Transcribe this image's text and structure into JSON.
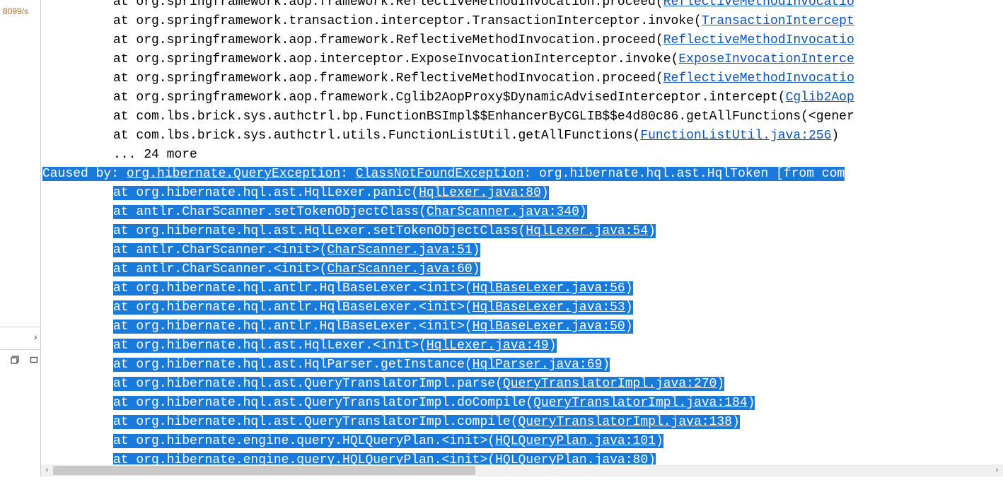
{
  "sidebar": {
    "top_text": "8099/s",
    "chevron_label": "›"
  },
  "trace": {
    "pre_lines": [
      {
        "prefix": "at org.springframework.aop.framework.ReflectiveMethodInvocation.proceed(",
        "link": "ReflectiveMethodInvocatio",
        "suffix": ""
      },
      {
        "prefix": "at org.springframework.transaction.interceptor.TransactionInterceptor.invoke(",
        "link": "TransactionIntercept",
        "suffix": ""
      },
      {
        "prefix": "at org.springframework.aop.framework.ReflectiveMethodInvocation.proceed(",
        "link": "ReflectiveMethodInvocatio",
        "suffix": ""
      },
      {
        "prefix": "at org.springframework.aop.interceptor.ExposeInvocationInterceptor.invoke(",
        "link": "ExposeInvocationInterce",
        "suffix": ""
      },
      {
        "prefix": "at org.springframework.aop.framework.ReflectiveMethodInvocation.proceed(",
        "link": "ReflectiveMethodInvocatio",
        "suffix": ""
      },
      {
        "prefix": "at org.springframework.aop.framework.Cglib2AopProxy$DynamicAdvisedInterceptor.intercept(",
        "link": "Cglib2Aop",
        "suffix": ""
      },
      {
        "prefix": "at com.lbs.brick.sys.authctrl.bp.FunctionBSImpl$$EnhancerByCGLIB$$e4d80c86.getAllFunctions(<gener",
        "link": "",
        "suffix": ""
      },
      {
        "prefix": "at com.lbs.brick.sys.authctrl.utils.FunctionListUtil.getAllFunctions(",
        "link": "FunctionListUtil.java:256",
        "suffix": ")"
      }
    ],
    "more_line": "... 24 more",
    "caused_by": {
      "label": "Caused by: ",
      "u1": "org.hibernate.QueryException",
      "mid1": ": ",
      "u2": "ClassNotFoundException",
      "mid2": ": org.hibernate.hql.ast.HqlToken [from com"
    },
    "sel_lines": [
      {
        "prefix": "at org.hibernate.hql.ast.HqlLexer.panic(",
        "link": "HqlLexer.java:80",
        "suffix": ")"
      },
      {
        "prefix": "at antlr.CharScanner.setTokenObjectClass(",
        "link": "CharScanner.java:340",
        "suffix": ")"
      },
      {
        "prefix": "at org.hibernate.hql.ast.HqlLexer.setTokenObjectClass(",
        "link": "HqlLexer.java:54",
        "suffix": ")"
      },
      {
        "prefix": "at antlr.CharScanner.<init>(",
        "link": "CharScanner.java:51",
        "suffix": ")"
      },
      {
        "prefix": "at antlr.CharScanner.<init>(",
        "link": "CharScanner.java:60",
        "suffix": ")"
      },
      {
        "prefix": "at org.hibernate.hql.antlr.HqlBaseLexer.<init>(",
        "link": "HqlBaseLexer.java:56",
        "suffix": ")"
      },
      {
        "prefix": "at org.hibernate.hql.antlr.HqlBaseLexer.<init>(",
        "link": "HqlBaseLexer.java:53",
        "suffix": ")"
      },
      {
        "prefix": "at org.hibernate.hql.antlr.HqlBaseLexer.<init>(",
        "link": "HqlBaseLexer.java:50",
        "suffix": ")"
      },
      {
        "prefix": "at org.hibernate.hql.ast.HqlLexer.<init>(",
        "link": "HqlLexer.java:49",
        "suffix": ")"
      },
      {
        "prefix": "at org.hibernate.hql.ast.HqlParser.getInstance(",
        "link": "HqlParser.java:69",
        "suffix": ")"
      },
      {
        "prefix": "at org.hibernate.hql.ast.QueryTranslatorImpl.parse(",
        "link": "QueryTranslatorImpl.java:270",
        "suffix": ")"
      },
      {
        "prefix": "at org.hibernate.hql.ast.QueryTranslatorImpl.doCompile(",
        "link": "QueryTranslatorImpl.java:184",
        "suffix": ")"
      },
      {
        "prefix": "at org.hibernate.hql.ast.QueryTranslatorImpl.compile(",
        "link": "QueryTranslatorImpl.java:138",
        "suffix": ")"
      },
      {
        "prefix": "at org.hibernate.engine.query.HQLQueryPlan.<init>(",
        "link": "HQLQueryPlan.java:101",
        "suffix": ")"
      },
      {
        "prefix": "at org.hibernate.engine.query.HQLQueryPlan.<init>(HQLQueryPlan.java:80)",
        "link": "",
        "suffix": ""
      }
    ]
  },
  "scrollbar": {
    "left_arrow": "‹",
    "right_arrow": "›"
  }
}
